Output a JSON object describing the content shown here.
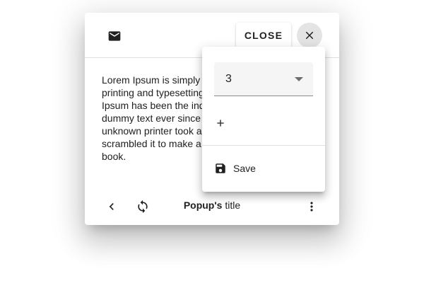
{
  "dialog": {
    "header": {
      "close_label": "CLOSE",
      "icons": {
        "leading": "mail-icon",
        "close": "close-icon"
      }
    },
    "body_text": "Lorem Ipsum is simply dummy text of the printing and typesetting industry. Lorem Ipsum has been the industrys standard dummy text ever since the 1500s, when an unknown printer took a galley of type and scrambled it to make a type specimen book.",
    "footer": {
      "title_bold": "Popup's",
      "title_rest": " title",
      "icons": [
        "chevron-left-icon",
        "sync-icon",
        "more-vert-icon"
      ]
    }
  },
  "menu": {
    "select": {
      "value": "3"
    },
    "add_icon": "plus-icon",
    "items": [
      {
        "label": "Save",
        "icon": "save-icon"
      }
    ]
  }
}
